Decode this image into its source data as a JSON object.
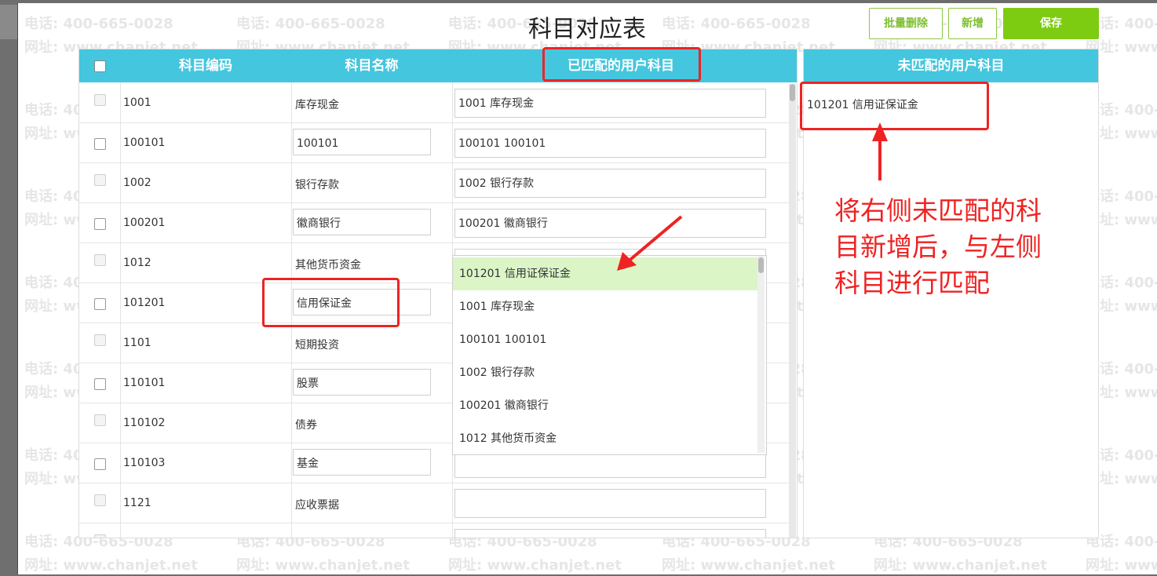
{
  "title": "科目对应表",
  "buttons": {
    "batch_delete": "批量删除",
    "add": "新增",
    "save": "保存"
  },
  "watermark": {
    "phone": "电话: 400-665-0028",
    "site": "网址: www.chanjet.net"
  },
  "left_table": {
    "headers": {
      "code": "科目编码",
      "name": "科目名称",
      "matched": "已匹配的用户科目"
    },
    "rows": [
      {
        "code": "1001",
        "name": "库存现金",
        "matched": "1001 库存现金"
      },
      {
        "code": "100101",
        "name": "100101",
        "matched": "100101 100101"
      },
      {
        "code": "1002",
        "name": "银行存款",
        "matched": "1002 银行存款"
      },
      {
        "code": "100201",
        "name": "徽商银行",
        "matched": "100201 徽商银行"
      },
      {
        "code": "1012",
        "name": "其他货币资金",
        "matched": ""
      },
      {
        "code": "101201",
        "name": "信用保证金",
        "matched": ""
      },
      {
        "code": "1101",
        "name": "短期投资",
        "matched": ""
      },
      {
        "code": "110101",
        "name": "股票",
        "matched": ""
      },
      {
        "code": "110102",
        "name": "债券",
        "matched": ""
      },
      {
        "code": "110103",
        "name": "基金",
        "matched": ""
      },
      {
        "code": "1121",
        "name": "应收票据",
        "matched": ""
      }
    ]
  },
  "dropdown": {
    "options": [
      "101201 信用证保证金",
      "1001 库存现金",
      "100101 100101",
      "1002 银行存款",
      "100201 徽商银行",
      "1012 其他货币资金"
    ],
    "selected": "101201 信用证保证金"
  },
  "right_table": {
    "header": "未匹配的用户科目",
    "items": [
      "101201 信用证保证金"
    ]
  },
  "annotation": {
    "line1": "将右侧未匹配的科",
    "line2": "目新增后，与左侧",
    "line3": "科目进行匹配"
  },
  "colors": {
    "header_bg": "#44c6de",
    "accent_green": "#7dcc12",
    "highlight": "#ee2323",
    "selected_row": "#dbf5c6"
  }
}
